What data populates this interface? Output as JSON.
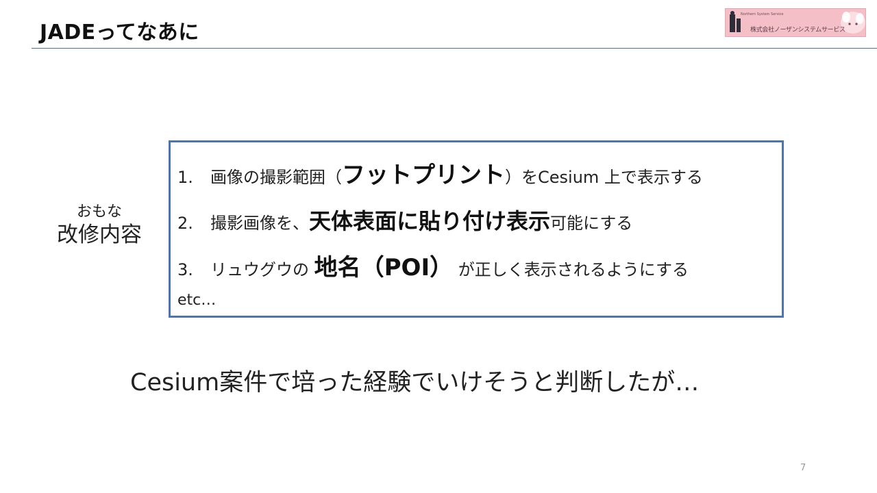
{
  "slide": {
    "title": "JADEってなあに",
    "page_number": "7"
  },
  "logo": {
    "small_text": "Northern System Service",
    "company": "株式会社ノーザンシステムサービス"
  },
  "side_label": {
    "line1": "おもな",
    "line2": "改修内容"
  },
  "items": [
    {
      "number": "1.",
      "before": "画像の撮影範囲（",
      "emphasis": "フットプリント",
      "after": "）をCesium 上で表示する"
    },
    {
      "number": "2.",
      "before": "撮影画像を、",
      "emphasis": "天体表面に貼り付け表示",
      "after": "可能にする"
    },
    {
      "number": "3.",
      "before": "リュウグウの ",
      "emphasis": "地名（POI）",
      "after": " が正しく表示されるようにする"
    }
  ],
  "etc": "etc…",
  "conclusion": "Cesium案件で培った経験でいけそうと判断したが…"
}
